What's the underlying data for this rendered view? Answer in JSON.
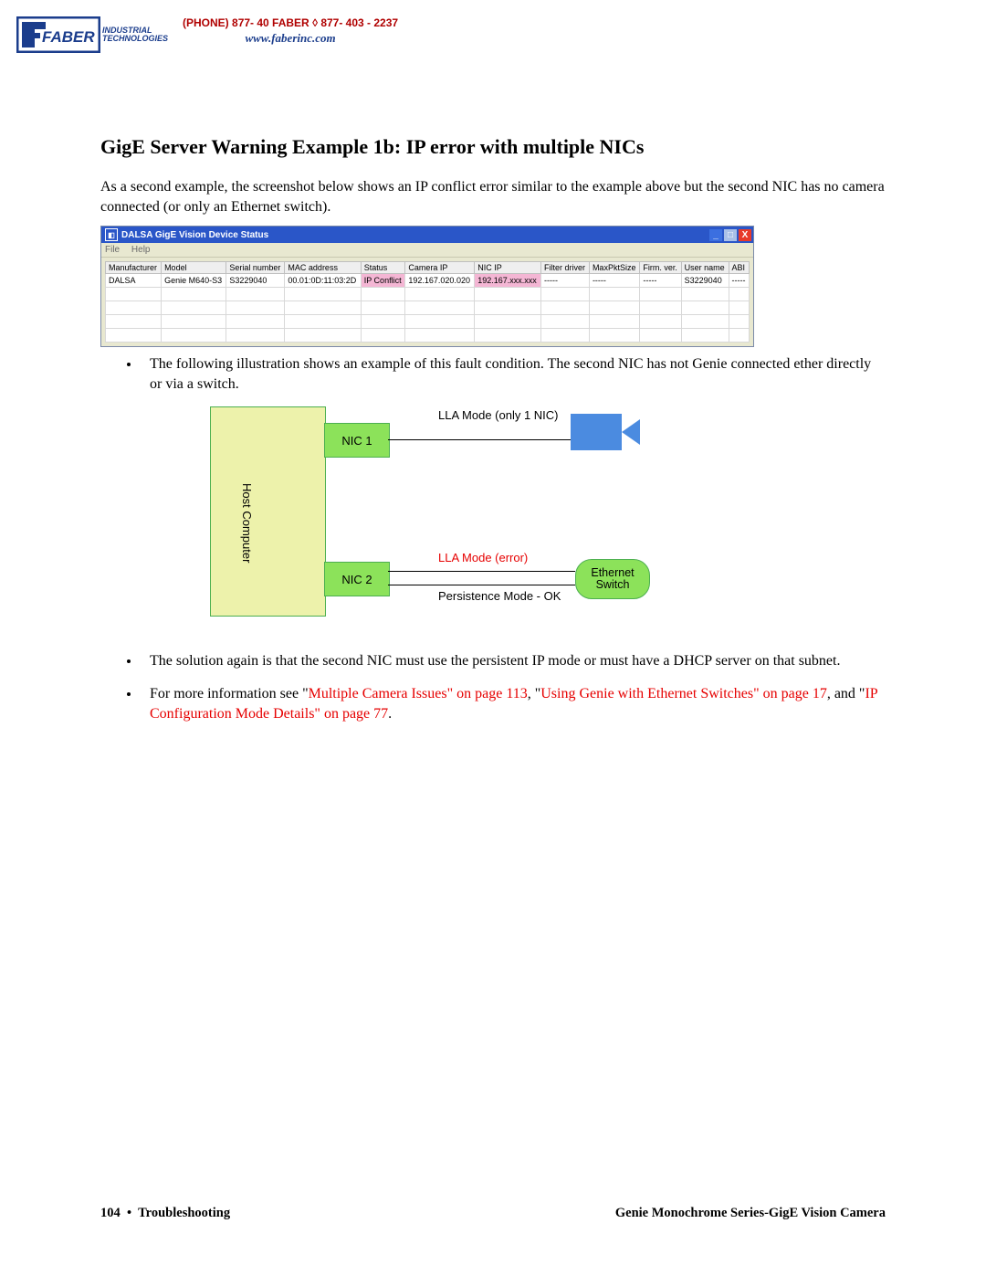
{
  "header": {
    "logo_text": "FABER",
    "logo_sub1": "INDUSTRIAL",
    "logo_sub2": "TECHNOLOGIES",
    "phone_label": "(PHONE) 877- 40 FABER",
    "phone_num": "877- 403 - 2237",
    "website": "www.faberinc.com"
  },
  "title": "GigE Server Warning Example 1b: IP error with multiple NICs",
  "intro": "As a second example, the screenshot below shows an IP conflict error similar to the example above but the second NIC has no camera connected (or only an Ethernet switch).",
  "window": {
    "title": "DALSA GigE Vision Device Status",
    "menu": {
      "file": "File",
      "help": "Help"
    },
    "buttons": {
      "min": "_",
      "max": "□",
      "close": "X"
    },
    "columns": [
      "Manufacturer",
      "Model",
      "Serial number",
      "MAC address",
      "Status",
      "Camera IP",
      "NIC IP",
      "Filter driver",
      "MaxPktSize",
      "Firm. ver.",
      "User name",
      "ABI"
    ],
    "row": {
      "manufacturer": "DALSA",
      "model": "Genie M640-S3",
      "serial": "S3229040",
      "mac": "00.01:0D:11:03:2D",
      "status": "IP Conflict",
      "camera_ip": "192.167.020.020",
      "nic_ip": "192.167.xxx.xxx",
      "filter": "-----",
      "maxpkt": "-----",
      "firm": "-----",
      "user": "S3229040",
      "abi": "-----"
    }
  },
  "bullet1": "The following illustration shows an example of this fault condition. The second NIC has not Genie connected ether directly or via a switch.",
  "diagram": {
    "host": "Host Computer",
    "nic1": "NIC 1",
    "nic2": "NIC 2",
    "ethernet_switch": "Ethernet Switch",
    "lla_ok": "LLA Mode (only 1 NIC)",
    "lla_err": "LLA Mode (error)",
    "persist": "Persistence Mode - OK"
  },
  "bullet2": "The solution again is that the second NIC must use the persistent IP mode or must have a DHCP server on that subnet.",
  "bullet3": {
    "pre": "For more information see ",
    "q1a": "\"",
    "link1": "Multiple Camera Issues\" on page 113",
    "mid1": ", \"",
    "link2": "Using Genie with Ethernet Switches\" on page 17",
    "mid2": ", and \"",
    "link3": "IP Configuration Mode Details\" on page 77",
    "end": "."
  },
  "footer": {
    "left_page": "104",
    "left_dot": "•",
    "left_section": "Troubleshooting",
    "right": "Genie Monochrome Series-GigE Vision Camera"
  }
}
